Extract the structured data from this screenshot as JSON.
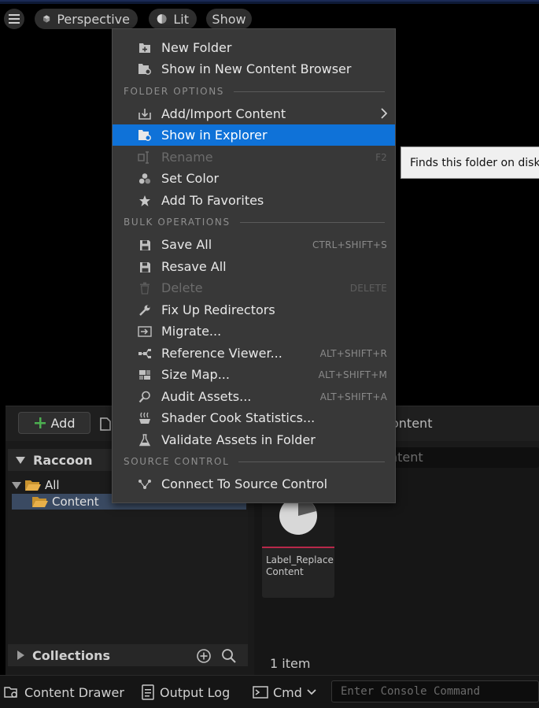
{
  "viewport": {
    "perspective_label": "Perspective",
    "lit_label": "Lit",
    "show_label": "Show"
  },
  "content_browser": {
    "add_label": "Add",
    "path_partial": "ontent",
    "search_partial": "ntent",
    "sources_root": "Raccoon",
    "tree": [
      {
        "label": "All"
      },
      {
        "label": "Content"
      }
    ],
    "collections_label": "Collections",
    "asset": {
      "name": "Label_ReplaceContent",
      "name_line1": "Label_Replace",
      "name_line2": "Content"
    },
    "item_count": "1 item"
  },
  "status_bar": {
    "content_drawer": "Content Drawer",
    "output_log": "Output Log",
    "cmd_label": "Cmd",
    "console_placeholder": "Enter Console Command"
  },
  "context_menu": {
    "items_top": [
      {
        "label": "New Folder",
        "icon": "new-folder-icon"
      },
      {
        "label": "Show in New Content Browser",
        "icon": "content-browser-icon"
      }
    ],
    "section_folder": "FOLDER OPTIONS",
    "items_folder": [
      {
        "label": "Add/Import Content",
        "icon": "import-icon",
        "submenu": true
      },
      {
        "label": "Show in Explorer",
        "icon": "explorer-icon",
        "highlighted": true
      },
      {
        "label": "Rename",
        "icon": "rename-icon",
        "shortcut": "F2",
        "disabled": true
      },
      {
        "label": "Set Color",
        "icon": "color-icon"
      },
      {
        "label": "Add To Favorites",
        "icon": "star-icon"
      }
    ],
    "section_bulk": "BULK OPERATIONS",
    "items_bulk": [
      {
        "label": "Save All",
        "icon": "save-icon",
        "shortcut": "CTRL+SHIFT+S"
      },
      {
        "label": "Resave All",
        "icon": "save-icon"
      },
      {
        "label": "Delete",
        "icon": "delete-icon",
        "shortcut": "DELETE",
        "disabled": true
      },
      {
        "label": "Fix Up Redirectors",
        "icon": "wrench-icon"
      },
      {
        "label": "Migrate...",
        "icon": "migrate-icon"
      },
      {
        "label": "Reference Viewer...",
        "icon": "reference-viewer-icon",
        "shortcut": "ALT+SHIFT+R"
      },
      {
        "label": "Size Map...",
        "icon": "size-map-icon",
        "shortcut": "ALT+SHIFT+M"
      },
      {
        "label": "Audit Assets...",
        "icon": "audit-icon",
        "shortcut": "ALT+SHIFT+A"
      },
      {
        "label": "Shader Cook Statistics...",
        "icon": "shader-icon"
      },
      {
        "label": "Validate Assets in Folder",
        "icon": "flask-icon"
      }
    ],
    "section_source": "SOURCE CONTROL",
    "items_source": [
      {
        "label": "Connect To Source Control",
        "icon": "source-control-icon"
      }
    ]
  },
  "tooltip": {
    "text": "Finds this folder on disk."
  },
  "colors": {
    "highlight": "#0f72d8",
    "menu_bg": "#383838",
    "asset_accent": "#b8284a",
    "add_plus": "#4caf50"
  }
}
